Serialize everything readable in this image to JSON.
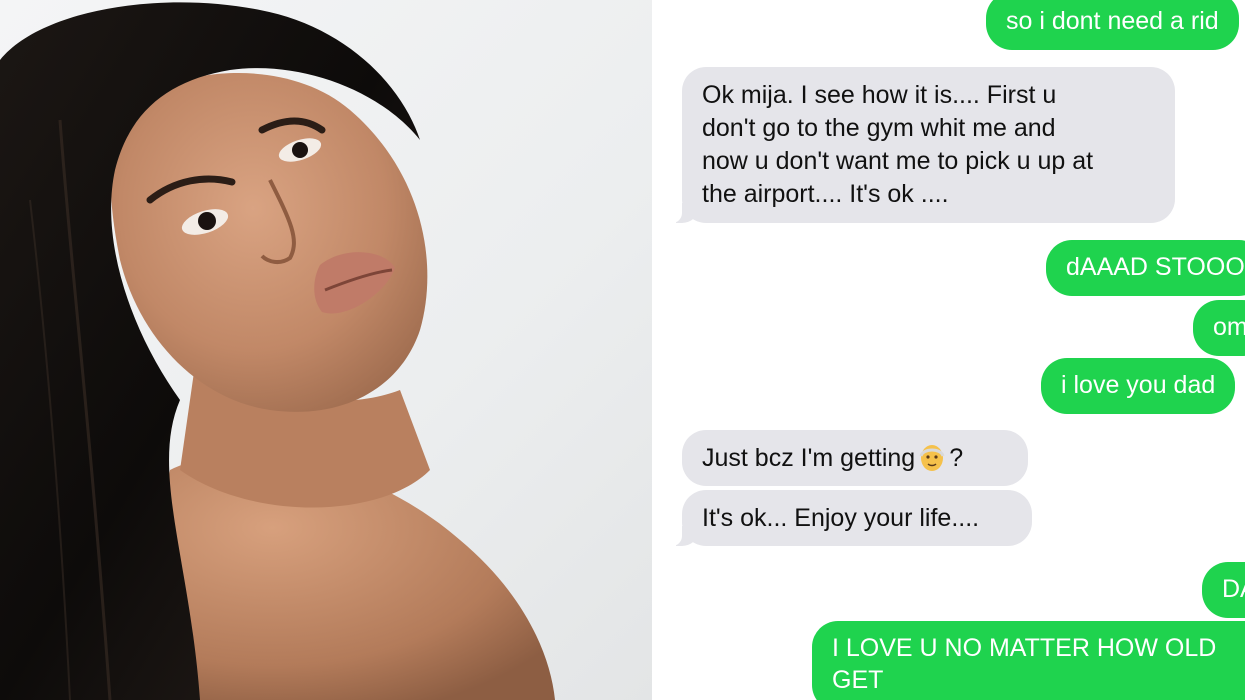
{
  "colors": {
    "outgoing_bubble": "#1fd34e",
    "incoming_bubble": "#e5e5ea",
    "incoming_text": "#111111",
    "outgoing_text": "#ffffff"
  },
  "photo": {
    "icon": "portrait-photo"
  },
  "messages": [
    {
      "direction": "outgoing",
      "text": "so i dont need a rid"
    },
    {
      "direction": "incoming",
      "text": "Ok mija. I see how it is.... First u\ndon't go to the gym whit me and\nnow u don't want me to pick u up at\nthe airport.... It's ok ...."
    },
    {
      "direction": "outgoing",
      "text": "dAAAD STOOO"
    },
    {
      "direction": "outgoing",
      "text": "om"
    },
    {
      "direction": "outgoing",
      "text": "i love you dad"
    },
    {
      "direction": "incoming",
      "text_before": "Just bcz I'm getting",
      "emoji": "older-man-emoji",
      "text_after": "?"
    },
    {
      "direction": "incoming",
      "text": "It's ok... Enjoy your life...."
    },
    {
      "direction": "outgoing",
      "text": "DA"
    },
    {
      "direction": "outgoing",
      "text": "I LOVE U NO MATTER HOW OLD\nGET"
    }
  ]
}
